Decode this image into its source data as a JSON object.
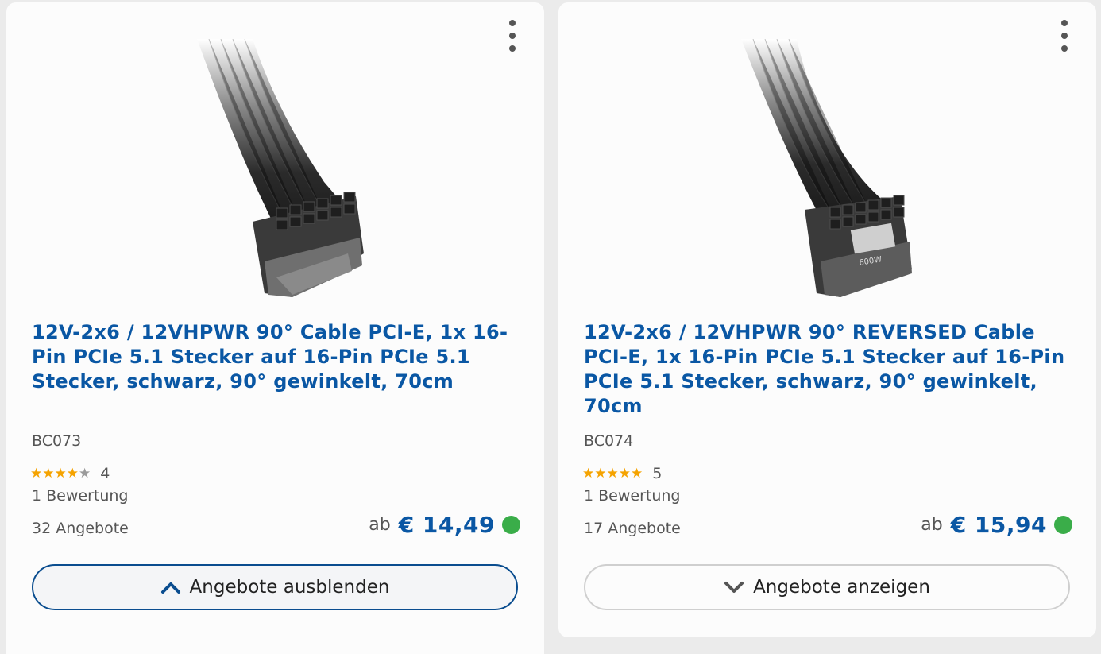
{
  "products": [
    {
      "title": "12V-2x6 / 12VHPWR 90° Cable PCI-E, 1x 16-Pin PCIe 5.1 Stecker auf 16-Pin PCIe 5.1 Stecker, schwarz, 90° gewinkelt, 70cm",
      "sku": "BC073",
      "rating": 4,
      "rating_label": "4",
      "rating_count": "1 Bewertung",
      "offers": "32 Angebote",
      "price_prefix": "ab",
      "price": "€ 14,49",
      "availability_color": "#3aad49",
      "offers_button": {
        "label": "Angebote ausblenden",
        "icon": "chevron-up-icon",
        "expanded": true
      },
      "menu_icon": "more-vertical-icon"
    },
    {
      "title": "12V-2x6 / 12VHPWR 90° REVERSED Cable PCI-E, 1x 16-Pin PCIe 5.1 Stecker auf 16-Pin PCIe 5.1 Stecker, schwarz, 90° gewinkelt, 70cm",
      "sku": "BC074",
      "rating": 5,
      "rating_label": "5",
      "rating_count": "1 Bewertung",
      "offers": "17 Angebote",
      "price_prefix": "ab",
      "price": "€ 15,94",
      "availability_color": "#3aad49",
      "offers_button": {
        "label": "Angebote anzeigen",
        "icon": "chevron-down-icon",
        "expanded": false
      },
      "menu_icon": "more-vertical-icon"
    }
  ],
  "colors": {
    "link": "#0a57a4",
    "star": "#f5a300",
    "in_stock": "#3aad49"
  }
}
